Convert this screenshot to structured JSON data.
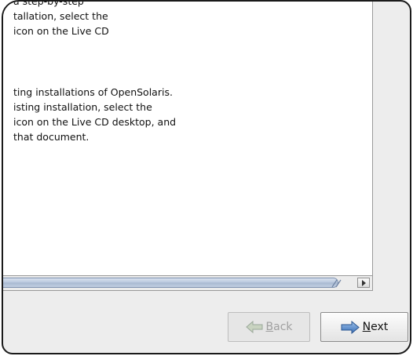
{
  "content": {
    "paragraph_1_lines": [
      "a step-by-step",
      "tallation, select the",
      "icon on the Live CD"
    ],
    "paragraph_2_lines": [
      "ting installations of OpenSolaris.",
      "isting installation, select the",
      "icon on the Live CD desktop, and",
      "that document."
    ]
  },
  "buttons": {
    "back": {
      "mnemonic": "B",
      "rest": "ack",
      "enabled": false
    },
    "next": {
      "mnemonic": "N",
      "rest": "ext",
      "enabled": true
    }
  },
  "colors": {
    "window_bg": "#ededed",
    "content_bg": "#ffffff",
    "scroll_thumb": "#b7c6dc",
    "arrow_green": "#6fa04a",
    "arrow_blue": "#3a6fb7",
    "disabled_text": "#a0a0a0"
  },
  "icons": {
    "back": "go-back-arrow-icon",
    "next": "go-next-arrow-icon",
    "scroll_right": "scroll-right-arrow-icon"
  }
}
